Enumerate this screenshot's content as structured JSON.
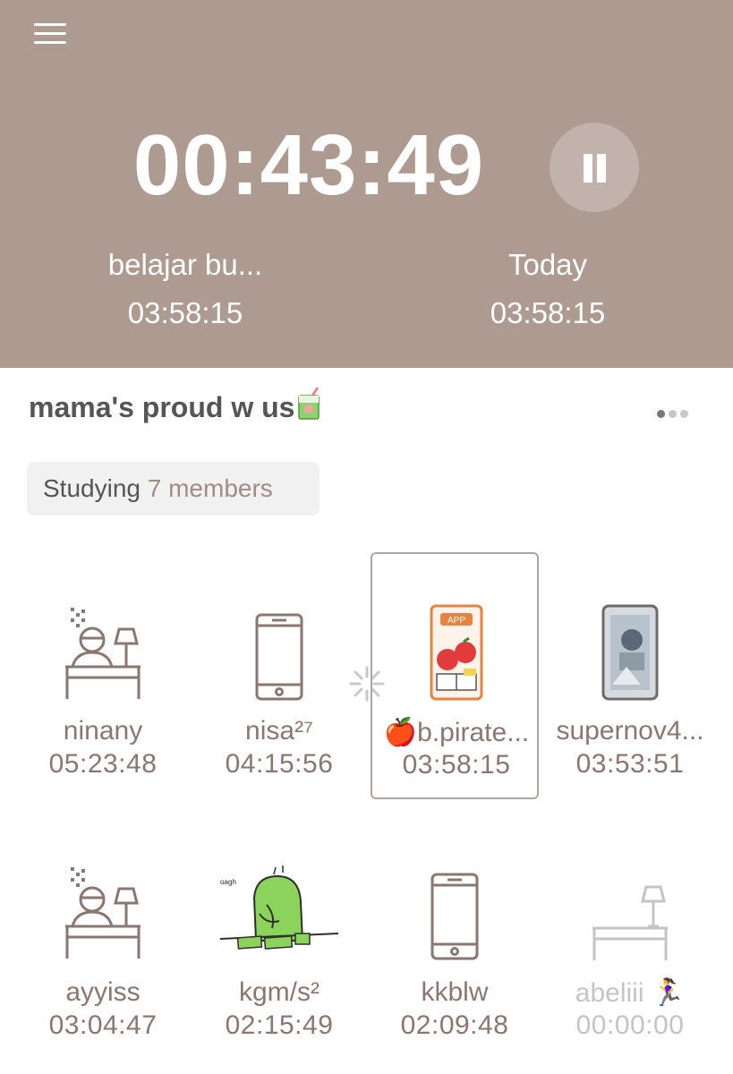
{
  "header": {
    "timer": "00:43:49",
    "subject": {
      "label": "belajar bu...",
      "value": "03:58:15"
    },
    "today": {
      "label": "Today",
      "value": "03:58:15"
    }
  },
  "group": {
    "title": "mama's proud w us",
    "status_label": "Studying",
    "status_count": "7 members"
  },
  "members": [
    {
      "name": "ninany",
      "time": "05:23:48",
      "avatar": "studying-desk-icon"
    },
    {
      "name": "nisa²⁷",
      "time": "04:15:56",
      "avatar": "phone-icon"
    },
    {
      "name": "🍎b.pirate...",
      "time": "03:58:15",
      "avatar": "app-phone-icon"
    },
    {
      "name": "supernov4...",
      "time": "03:53:51",
      "avatar": "space-phone-icon"
    },
    {
      "name": "ayyiss",
      "time": "03:04:47",
      "avatar": "studying-desk-icon"
    },
    {
      "name": "kgm/s²",
      "time": "02:15:49",
      "avatar": "green-studying-character"
    },
    {
      "name": "kkblw",
      "time": "02:09:48",
      "avatar": "phone-icon"
    },
    {
      "name": "abeliii 🏃‍♀️",
      "time": "00:00:00",
      "avatar": "empty-desk-icon"
    }
  ],
  "colors": {
    "header_bg": "#ad9a91",
    "accent_text": "#8a7770",
    "inactive_text": "#c4c4c4"
  }
}
